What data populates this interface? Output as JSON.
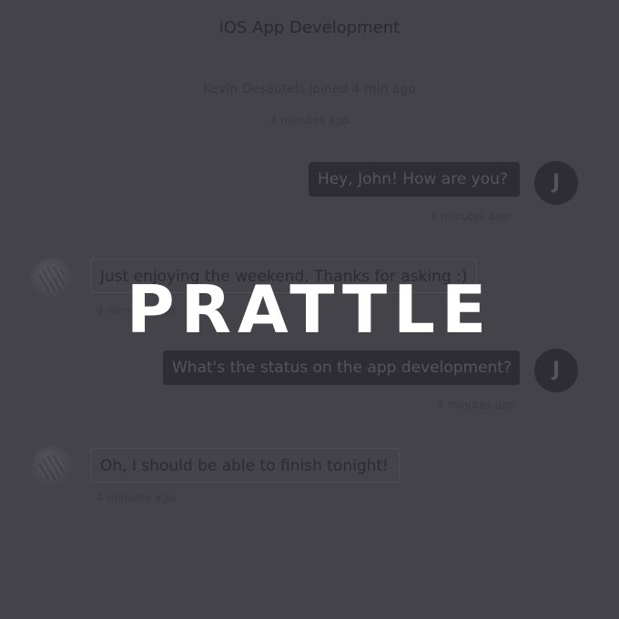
{
  "header": {
    "title": "iOS App Development"
  },
  "system": {
    "line1": "Kevin Desautels joined 4 min ago",
    "line2": "4 minutes ago"
  },
  "messages": [
    {
      "direction": "out",
      "text": "Hey, John! How are you?",
      "time": "4 minutes ago",
      "avatar": "J"
    },
    {
      "direction": "in",
      "text": "Just enjoying the weekend. Thanks for asking :)",
      "time": "4 minutes ago",
      "avatar": "photo"
    },
    {
      "direction": "out",
      "text": "What's the status on the app development?",
      "time": "4 minutes ago",
      "avatar": "J"
    },
    {
      "direction": "in",
      "text": "Oh, I should be able to finish tonight!",
      "time": "4 minutes ago",
      "avatar": "photo"
    }
  ],
  "overlay": {
    "brand": "PRATTLE"
  }
}
